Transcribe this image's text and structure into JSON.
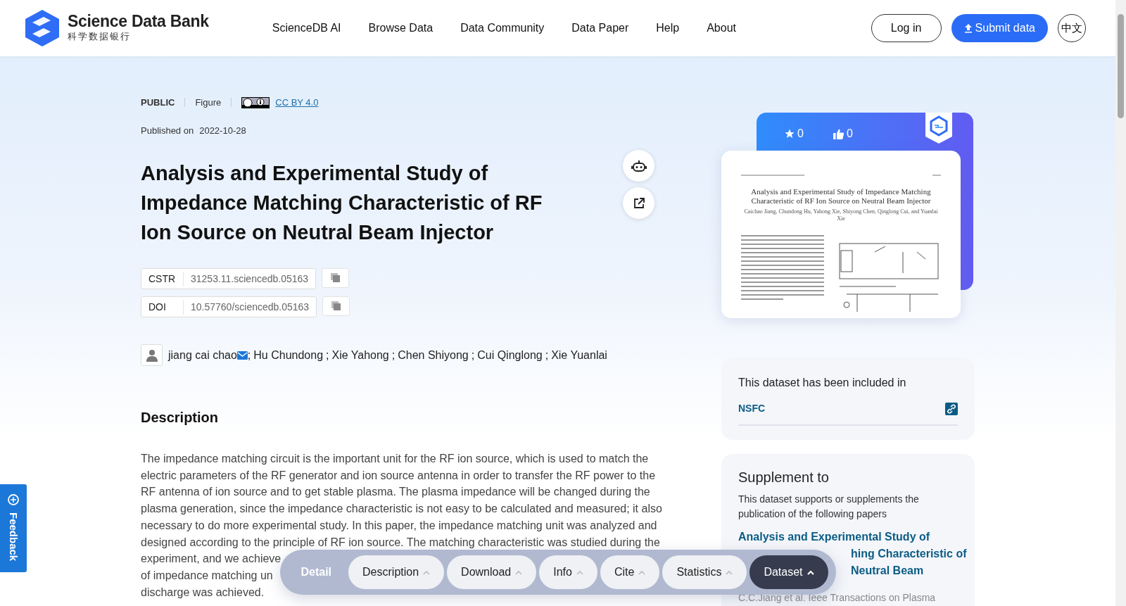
{
  "header": {
    "logo": {
      "title": "Science Data Bank",
      "subtitle": "科学数据银行"
    },
    "nav": [
      {
        "label": "ScienceDB AI"
      },
      {
        "label": "Browse Data"
      },
      {
        "label": "Data Community"
      },
      {
        "label": "Data Paper"
      },
      {
        "label": "Help"
      },
      {
        "label": "About"
      }
    ],
    "login": "Log in",
    "submit": "Submit data",
    "language": "中文"
  },
  "dataset": {
    "access": "PUBLIC",
    "type": "Figure",
    "license": "CC BY 4.0",
    "published_label": "Published on",
    "published_date": "2022-10-28",
    "title": "Analysis and Experimental Study of Impedance Matching Characteristic of RF Ion Source on Neutral Beam Injector",
    "identifiers": [
      {
        "label": "CSTR",
        "value": "31253.11.sciencedb.05163"
      },
      {
        "label": "DOI",
        "value": "10.57760/sciencedb.05163"
      }
    ],
    "author_separator": ";",
    "authors": [
      {
        "name": "jiang cai chao",
        "email": true
      },
      {
        "name": "Hu Chundong",
        "email": false
      },
      {
        "name": "Xie Yahong",
        "email": false
      },
      {
        "name": "Chen Shiyong",
        "email": false
      },
      {
        "name": "Cui Qinglong",
        "email": false
      },
      {
        "name": "Xie Yuanlai",
        "email": false
      }
    ],
    "description": {
      "heading": "Description",
      "lines": [
        "The impedance matching circuit is the important unit for the RF ion source, which is used to match the",
        "electric parameters of the RF generator and ion source antenna in order to transfer the RF power to the",
        "RF antenna of ion source and to get stable plasma. The plasma impedance will be changed during the",
        "plasma generation, since the impedance characteristic is not easy to be calculated and measured; it also",
        "necessary to do more experimental study. In this paper, the impedance matching unit was analyzed and",
        "designed according to the principle of RF ion source. The matching characteristic was studied during the",
        "experiment, and we achieve",
        "of impedance matching un",
        "discharge was achieved."
      ]
    }
  },
  "stats": {
    "favorites": "0",
    "likes": "0"
  },
  "preview": {
    "title": "Analysis and Experimental Study of Impedance Matching Characteristic of RF Ion Source on Neutral Beam Injector",
    "authors": "Caichao Jiang, Chundong Hu, Yahong Xie, Shiyong Chen, Qinglong Cui, and Yuanlai Xie"
  },
  "included": {
    "heading": "This dataset has been included in",
    "items": [
      {
        "name": "NSFC"
      }
    ]
  },
  "supplement": {
    "heading": "Supplement to",
    "text": "This dataset supports or supplements the publication of the following papers",
    "paper_lines": [
      "Analysis and Experimental Study of",
      "hing Characteristic of",
      "Neutral Beam"
    ],
    "citation": "C.C.Jiang et al. Ieee Transactions on Plasma"
  },
  "feedback": "Feedback",
  "section_bar": {
    "label": "Detail",
    "tabs": [
      {
        "label": "Description",
        "selected": false
      },
      {
        "label": "Download",
        "selected": false
      },
      {
        "label": "Info",
        "selected": false
      },
      {
        "label": "Cite",
        "selected": false
      },
      {
        "label": "Statistics",
        "selected": false
      },
      {
        "label": "Dataset",
        "selected": true
      }
    ]
  }
}
